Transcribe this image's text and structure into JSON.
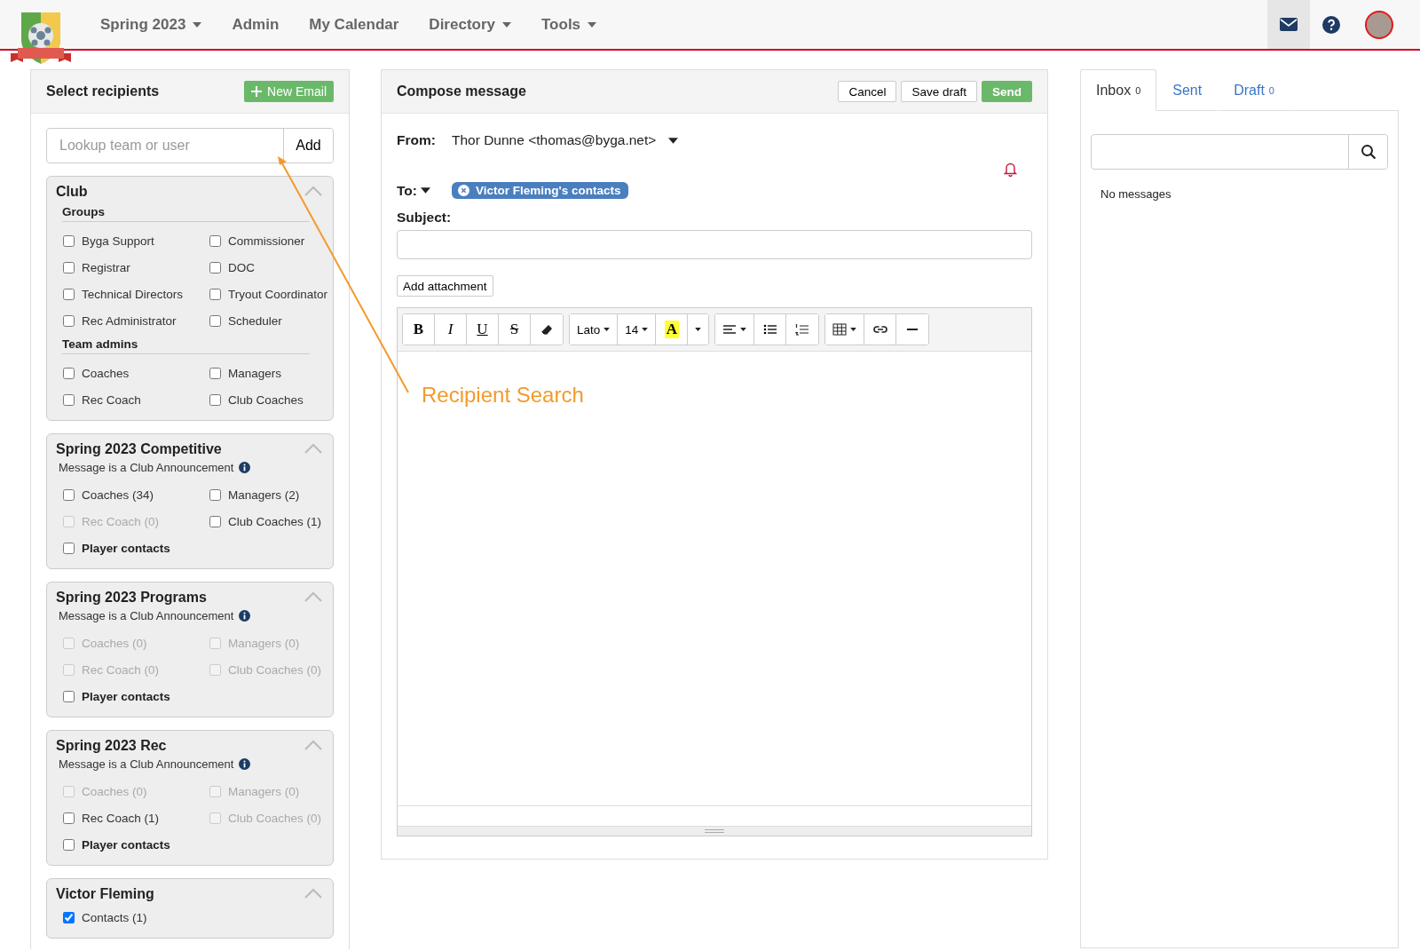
{
  "nav": {
    "items": [
      {
        "label": "Spring 2023",
        "dropdown": true
      },
      {
        "label": "Admin",
        "dropdown": false
      },
      {
        "label": "My Calendar",
        "dropdown": false
      },
      {
        "label": "Directory",
        "dropdown": true
      },
      {
        "label": "Tools",
        "dropdown": true
      }
    ],
    "mail_selected": true
  },
  "recipients": {
    "title": "Select recipients",
    "new_button": "New Email",
    "lookup": {
      "placeholder": "Lookup team or user"
    },
    "add_button": "Add",
    "sections": [
      {
        "title": "Club",
        "expanded": true,
        "groups": [
          {
            "heading": "Groups",
            "items": [
              {
                "label": "Byga Support",
                "checked": false,
                "disabled": false,
                "kind": "option"
              },
              {
                "label": "Commissioner",
                "checked": false,
                "disabled": false,
                "kind": "option"
              },
              {
                "label": "Registrar",
                "checked": false,
                "disabled": false,
                "kind": "option"
              },
              {
                "label": "DOC",
                "checked": false,
                "disabled": false,
                "kind": "option"
              },
              {
                "label": "Technical Directors",
                "checked": false,
                "disabled": false,
                "kind": "option"
              },
              {
                "label": "Tryout Coordinator",
                "checked": false,
                "disabled": false,
                "kind": "option"
              },
              {
                "label": "Rec Administrator",
                "checked": false,
                "disabled": false,
                "kind": "option"
              },
              {
                "label": "Scheduler",
                "checked": false,
                "disabled": false,
                "kind": "option"
              }
            ]
          },
          {
            "heading": "Team admins",
            "items": [
              {
                "label": "Coaches",
                "checked": false,
                "disabled": false,
                "kind": "option"
              },
              {
                "label": "Managers",
                "checked": false,
                "disabled": false,
                "kind": "option"
              },
              {
                "label": "Rec Coach",
                "checked": false,
                "disabled": false,
                "kind": "option"
              },
              {
                "label": "Club Coaches",
                "checked": false,
                "disabled": false,
                "kind": "option"
              }
            ]
          }
        ]
      },
      {
        "title": "Spring 2023 Competitive",
        "expanded": true,
        "note": "Message is a Club Announcement",
        "groups": [
          {
            "items": [
              {
                "label": "Coaches (34)",
                "checked": false,
                "disabled": false,
                "kind": "option"
              },
              {
                "label": "Managers (2)",
                "checked": false,
                "disabled": false,
                "kind": "option"
              },
              {
                "label": "Rec Coach (0)",
                "checked": false,
                "disabled": true,
                "kind": "option"
              },
              {
                "label": "Club Coaches (1)",
                "checked": false,
                "disabled": false,
                "kind": "option"
              },
              {
                "label": "Player contacts",
                "checked": false,
                "disabled": false,
                "kind": "contacts"
              }
            ]
          }
        ]
      },
      {
        "title": "Spring 2023 Programs",
        "expanded": true,
        "note": "Message is a Club Announcement",
        "groups": [
          {
            "items": [
              {
                "label": "Coaches (0)",
                "checked": false,
                "disabled": true,
                "kind": "option"
              },
              {
                "label": "Managers (0)",
                "checked": false,
                "disabled": true,
                "kind": "option"
              },
              {
                "label": "Rec Coach (0)",
                "checked": false,
                "disabled": true,
                "kind": "option"
              },
              {
                "label": "Club Coaches (0)",
                "checked": false,
                "disabled": true,
                "kind": "option"
              },
              {
                "label": "Player contacts",
                "checked": false,
                "disabled": false,
                "kind": "contacts"
              }
            ]
          }
        ]
      },
      {
        "title": "Spring 2023 Rec",
        "expanded": true,
        "note": "Message is a Club Announcement",
        "groups": [
          {
            "items": [
              {
                "label": "Coaches (0)",
                "checked": false,
                "disabled": true,
                "kind": "option"
              },
              {
                "label": "Managers (0)",
                "checked": false,
                "disabled": true,
                "kind": "option"
              },
              {
                "label": "Rec Coach (1)",
                "checked": false,
                "disabled": false,
                "kind": "option"
              },
              {
                "label": "Club Coaches (0)",
                "checked": false,
                "disabled": true,
                "kind": "option"
              },
              {
                "label": "Player contacts",
                "checked": false,
                "disabled": false,
                "kind": "contacts"
              }
            ]
          }
        ]
      },
      {
        "title": "Victor Fleming",
        "expanded": true,
        "groups": [
          {
            "items": [
              {
                "label": "Contacts (1)",
                "checked": true,
                "disabled": false,
                "kind": "option"
              }
            ]
          }
        ]
      }
    ]
  },
  "compose": {
    "title": "Compose message",
    "buttons": [
      {
        "label": "Cancel",
        "kind": "default"
      },
      {
        "label": "Save draft",
        "kind": "default"
      },
      {
        "label": "Send",
        "kind": "primary"
      }
    ],
    "from_label": "From:",
    "from_value": "Thor Dunne <thomas@byga.net>",
    "to_label": "To:",
    "recipients": [
      "Victor Fleming's contacts"
    ],
    "subject_label": "Subject:",
    "attachment_button": "Add attachment",
    "toolbar": {
      "format": [
        {
          "label": "B",
          "kind": "bold"
        },
        {
          "label": "I",
          "kind": "italic"
        },
        {
          "label": "U",
          "kind": "underline"
        },
        {
          "label": "S",
          "kind": "strike"
        }
      ],
      "font": "Lato",
      "size": "14",
      "highlight": "A"
    }
  },
  "annotation": {
    "text": "Recipient Search"
  },
  "mailbox": {
    "tabs": [
      {
        "label": "Inbox",
        "count": "0",
        "selected": true
      },
      {
        "label": "Sent",
        "selected": false
      },
      {
        "label": "Draft",
        "count": "0",
        "selected": false
      }
    ],
    "empty_text": "No messages"
  }
}
